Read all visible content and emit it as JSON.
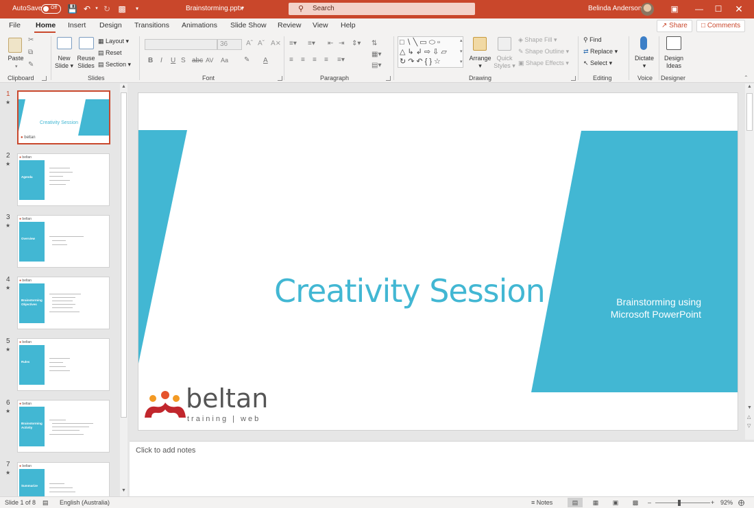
{
  "titlebar": {
    "autosave_label": "AutoSave",
    "autosave_state": "Off",
    "filename": "Brainstorming.pptx",
    "search_placeholder": "Search",
    "user_name": "Belinda Anderson",
    "accent_color": "#c9472b"
  },
  "tabs": [
    {
      "label": "File"
    },
    {
      "label": "Home",
      "active": true
    },
    {
      "label": "Insert"
    },
    {
      "label": "Design"
    },
    {
      "label": "Transitions"
    },
    {
      "label": "Animations"
    },
    {
      "label": "Slide Show"
    },
    {
      "label": "Review"
    },
    {
      "label": "View"
    },
    {
      "label": "Help"
    }
  ],
  "share_label": "Share",
  "comments_label": "Comments",
  "ribbon": {
    "clipboard": {
      "group": "Clipboard",
      "paste": "Paste"
    },
    "slides": {
      "group": "Slides",
      "new_slide_1": "New",
      "new_slide_2": "Slide",
      "reuse_1": "Reuse",
      "reuse_2": "Slides",
      "layout": "Layout",
      "reset": "Reset",
      "section": "Section"
    },
    "font": {
      "group": "Font",
      "size": "36"
    },
    "paragraph": {
      "group": "Paragraph"
    },
    "drawing": {
      "group": "Drawing",
      "arrange": "Arrange",
      "quick_styles_1": "Quick",
      "quick_styles_2": "Styles",
      "shape_fill": "Shape Fill",
      "shape_outline": "Shape Outline",
      "shape_effects": "Shape Effects"
    },
    "editing": {
      "group": "Editing",
      "find": "Find",
      "replace": "Replace",
      "select": "Select"
    },
    "voice": {
      "group": "Voice",
      "dictate": "Dictate"
    },
    "designer": {
      "group": "Designer",
      "design_ideas_1": "Design",
      "design_ideas_2": "Ideas"
    }
  },
  "thumbnails": [
    {
      "num": "1",
      "title": "Creativity Session",
      "logo": "beltan"
    },
    {
      "num": "2",
      "title": "Agenda",
      "logo": "beltan"
    },
    {
      "num": "3",
      "title": "Overview",
      "logo": "beltan"
    },
    {
      "num": "4",
      "title": "Brainstorming Objectives",
      "logo": "beltan"
    },
    {
      "num": "5",
      "title": "Rules",
      "logo": "beltan"
    },
    {
      "num": "6",
      "title": "Brainstorming Activity",
      "logo": "beltan"
    },
    {
      "num": "7",
      "title": "Summarize",
      "logo": "beltan"
    }
  ],
  "slide": {
    "title": "Creativity Session",
    "subtitle_line1": "Brainstorming using",
    "subtitle_line2": "Microsoft PowerPoint",
    "logo_main": "beltan",
    "logo_sub": "training | web",
    "band_color": "#42b7d3"
  },
  "notes_placeholder": "Click to add notes",
  "status": {
    "slide_indicator": "Slide 1 of 8",
    "language": "English (Australia)",
    "notes_label": "Notes",
    "zoom": "92%"
  }
}
